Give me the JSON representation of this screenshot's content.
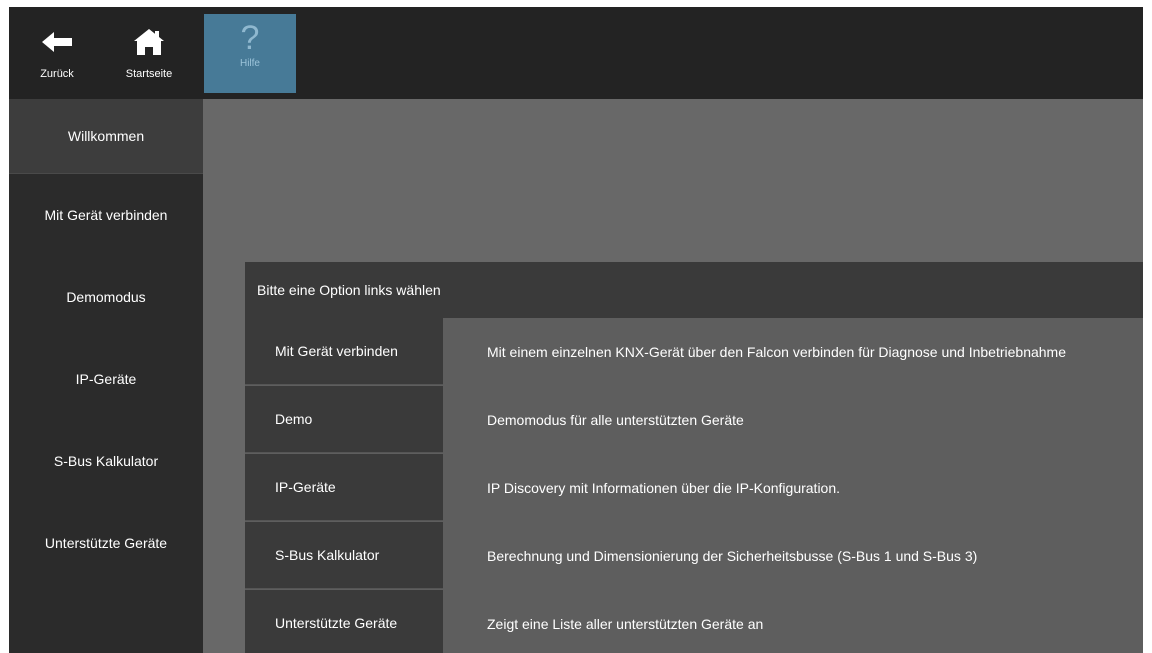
{
  "toolbar": {
    "back_label": "Zurück",
    "back_icon": "arrow-left-icon",
    "home_label": "Startseite",
    "home_icon": "home-icon",
    "help_label": "Hilfe",
    "help_glyph": "?",
    "help_icon": "question-mark-icon",
    "help_accent": "#477a97"
  },
  "sidebar": {
    "items": [
      {
        "label": "Willkommen",
        "active": true
      },
      {
        "label": "Mit Gerät verbinden"
      },
      {
        "label": "Demomodus"
      },
      {
        "label": "IP-Geräte"
      },
      {
        "label": "S-Bus Kalkulator"
      },
      {
        "label": "Unterstützte Geräte"
      }
    ]
  },
  "panel": {
    "header": "Bitte eine Option links wählen",
    "rows": [
      {
        "label": "Mit Gerät verbinden",
        "description": "Mit einem einzelnen KNX-Gerät über den Falcon verbinden für Diagnose und Inbetriebnahme"
      },
      {
        "label": "Demo",
        "description": "Demomodus für alle unterstützten Geräte"
      },
      {
        "label": "IP-Geräte",
        "description": "IP Discovery mit Informationen über die IP-Konfiguration."
      },
      {
        "label": "S-Bus Kalkulator",
        "description": "Berechnung und Dimensionierung der Sicherheitsbusse (S-Bus 1 und S-Bus 3)"
      },
      {
        "label": "Unterstützte Geräte",
        "description": "Zeigt eine Liste aller unterstützten Geräte an"
      }
    ]
  }
}
